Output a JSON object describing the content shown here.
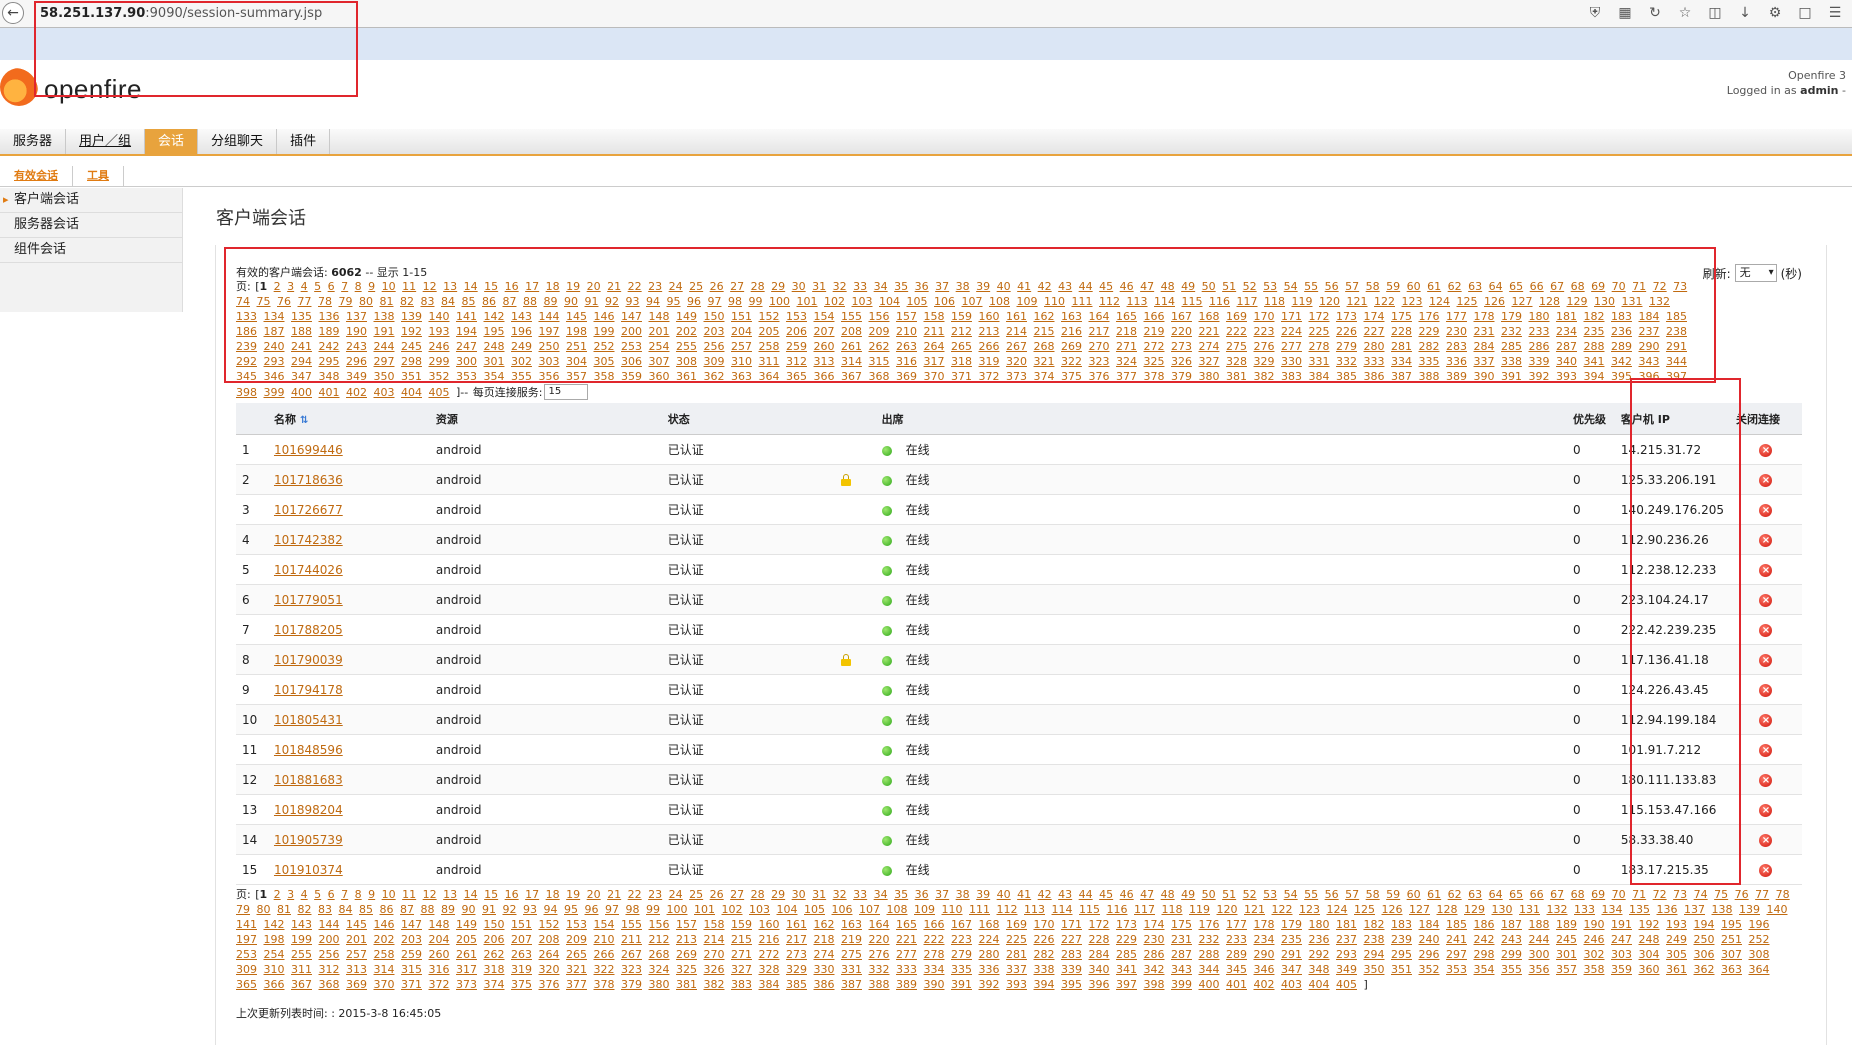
{
  "browser": {
    "url_host": "58.251.137.90",
    "url_rest": ":9090/session-summary.jsp"
  },
  "header": {
    "logo_text": "openfire",
    "version_text": "Openfire 3",
    "logged_in_label": "Logged in as",
    "logged_in_user": "admin",
    "logged_in_suffix": "-"
  },
  "nav": {
    "tabs": [
      "服务器",
      "用户／组",
      "会话",
      "分组聊天",
      "插件"
    ],
    "active": 2
  },
  "subnav": {
    "tabs": [
      "有效会话",
      "工具"
    ]
  },
  "sidebar": {
    "items": [
      "客户端会话",
      "服务器会话",
      "组件会话"
    ]
  },
  "page": {
    "title": "客户端会话",
    "summary_label": "有效的客户端会话:",
    "summary_count": "6062",
    "summary_range": "-- 显示 1-15",
    "refresh_label": "刷新:",
    "refresh_value": "无",
    "refresh_unit": "(秒)",
    "page_label": "页: [",
    "page_close": "]",
    "per_page_label": "-- 每页连接服务:",
    "per_page_value": "15",
    "total_pages": 405,
    "current_page": 1,
    "last_update_label": "上次更新列表时间:",
    "last_update_value": ": 2015-3-8 16:45:05"
  },
  "table": {
    "headers": {
      "name": "名称",
      "resource": "资源",
      "status": "状态",
      "presence": "出席",
      "priority": "优先级",
      "ip": "客户机 IP",
      "close": "关闭连接"
    },
    "rows": [
      {
        "n": "1",
        "name": "101699446",
        "resource": "android",
        "status": "已认证",
        "lock": false,
        "presence": "在线",
        "priority": "0",
        "ip": "14.215.31.72"
      },
      {
        "n": "2",
        "name": "101718636",
        "resource": "android",
        "status": "已认证",
        "lock": true,
        "presence": "在线",
        "priority": "0",
        "ip": "125.33.206.191"
      },
      {
        "n": "3",
        "name": "101726677",
        "resource": "android",
        "status": "已认证",
        "lock": false,
        "presence": "在线",
        "priority": "0",
        "ip": "140.249.176.205"
      },
      {
        "n": "4",
        "name": "101742382",
        "resource": "android",
        "status": "已认证",
        "lock": false,
        "presence": "在线",
        "priority": "0",
        "ip": "112.90.236.26"
      },
      {
        "n": "5",
        "name": "101744026",
        "resource": "android",
        "status": "已认证",
        "lock": false,
        "presence": "在线",
        "priority": "0",
        "ip": "112.238.12.233"
      },
      {
        "n": "6",
        "name": "101779051",
        "resource": "android",
        "status": "已认证",
        "lock": false,
        "presence": "在线",
        "priority": "0",
        "ip": "223.104.24.17"
      },
      {
        "n": "7",
        "name": "101788205",
        "resource": "android",
        "status": "已认证",
        "lock": false,
        "presence": "在线",
        "priority": "0",
        "ip": "222.42.239.235"
      },
      {
        "n": "8",
        "name": "101790039",
        "resource": "android",
        "status": "已认证",
        "lock": true,
        "presence": "在线",
        "priority": "0",
        "ip": "117.136.41.18"
      },
      {
        "n": "9",
        "name": "101794178",
        "resource": "android",
        "status": "已认证",
        "lock": false,
        "presence": "在线",
        "priority": "0",
        "ip": "124.226.43.45"
      },
      {
        "n": "10",
        "name": "101805431",
        "resource": "android",
        "status": "已认证",
        "lock": false,
        "presence": "在线",
        "priority": "0",
        "ip": "112.94.199.184"
      },
      {
        "n": "11",
        "name": "101848596",
        "resource": "android",
        "status": "已认证",
        "lock": false,
        "presence": "在线",
        "priority": "0",
        "ip": "101.91.7.212"
      },
      {
        "n": "12",
        "name": "101881683",
        "resource": "android",
        "status": "已认证",
        "lock": false,
        "presence": "在线",
        "priority": "0",
        "ip": "180.111.133.83"
      },
      {
        "n": "13",
        "name": "101898204",
        "resource": "android",
        "status": "已认证",
        "lock": false,
        "presence": "在线",
        "priority": "0",
        "ip": "115.153.47.166"
      },
      {
        "n": "14",
        "name": "101905739",
        "resource": "android",
        "status": "已认证",
        "lock": false,
        "presence": "在线",
        "priority": "0",
        "ip": "58.33.38.40"
      },
      {
        "n": "15",
        "name": "101910374",
        "resource": "android",
        "status": "已认证",
        "lock": false,
        "presence": "在线",
        "priority": "0",
        "ip": "183.17.215.35"
      }
    ]
  },
  "colors": {
    "accent": "#e8a33d",
    "link": "#c06a10",
    "highlight_box": "#e0262d"
  }
}
